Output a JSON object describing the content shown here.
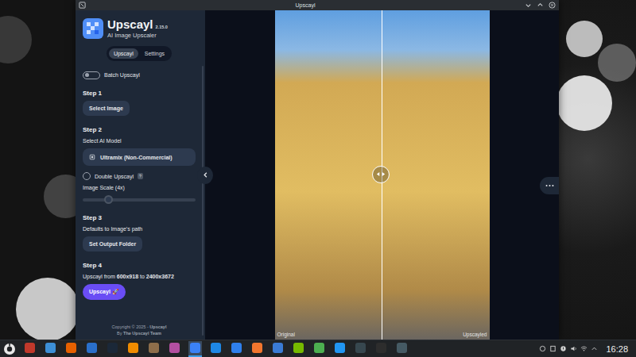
{
  "window": {
    "title": "Upscayl"
  },
  "app": {
    "name": "Upscayl",
    "version": "2.15.0",
    "tagline": "AI Image Upscaler"
  },
  "tabs": [
    {
      "label": "Upscayl",
      "selected": true
    },
    {
      "label": "Settings",
      "selected": false
    }
  ],
  "batch": {
    "label": "Batch Upscayl",
    "on": false
  },
  "step1": {
    "title": "Step 1",
    "button": "Select Image"
  },
  "step2": {
    "title": "Step 2",
    "label": "Select AI Model",
    "model": "Ultramix (Non-Commercial)",
    "double": {
      "label": "Double Upscayl",
      "checked": false,
      "help": "?"
    },
    "scale": {
      "label": "Image Scale (4x)",
      "level": 0.2
    }
  },
  "step3": {
    "title": "Step 3",
    "hint": "Defaults to Image's path",
    "button": "Set Output Folder"
  },
  "step4": {
    "title": "Step 4",
    "summary": [
      {
        "text": "Upscayl from ",
        "bold": false
      },
      {
        "text": "600x918",
        "bold": true
      },
      {
        "text": " to ",
        "bold": false
      },
      {
        "text": "2400x3672",
        "bold": true
      }
    ],
    "button": "Upscayl 🚀"
  },
  "footer": {
    "line1": [
      {
        "text": "Copyright © 2025 - ",
        "bold": false
      },
      {
        "text": "Upscayl",
        "bold": true
      }
    ],
    "line2": [
      {
        "text": "By ",
        "bold": false
      },
      {
        "text": "The Upscayl Team",
        "bold": true
      }
    ]
  },
  "viewer": {
    "left_label": "Original",
    "right_label": "Upscayled"
  },
  "taskbar": {
    "apps": [
      {
        "color": "#c0392b",
        "selected": false
      },
      {
        "color": "#3d8fd6",
        "selected": false
      },
      {
        "color": "#e66000",
        "selected": false
      },
      {
        "color": "#2a6fc9",
        "selected": false
      },
      {
        "color": "#1b2838",
        "selected": false
      },
      {
        "color": "#f08c00",
        "selected": false
      },
      {
        "color": "#8e6e4a",
        "selected": false
      },
      {
        "color": "#b34fa0",
        "selected": false
      },
      {
        "color": "#3b82f6",
        "selected": true
      },
      {
        "color": "#1e88e5",
        "selected": false
      },
      {
        "color": "#2f80ed",
        "selected": false
      },
      {
        "color": "#f2762e",
        "selected": false
      },
      {
        "color": "#3a7bd5",
        "selected": false
      },
      {
        "color": "#76b900",
        "selected": false
      },
      {
        "color": "#4caf50",
        "selected": false
      },
      {
        "color": "#2196f3",
        "selected": false
      },
      {
        "color": "#37474f",
        "selected": false
      },
      {
        "color": "#2d2d2d",
        "selected": false
      },
      {
        "color": "#455a64",
        "selected": false
      }
    ],
    "clock": "16:28"
  }
}
